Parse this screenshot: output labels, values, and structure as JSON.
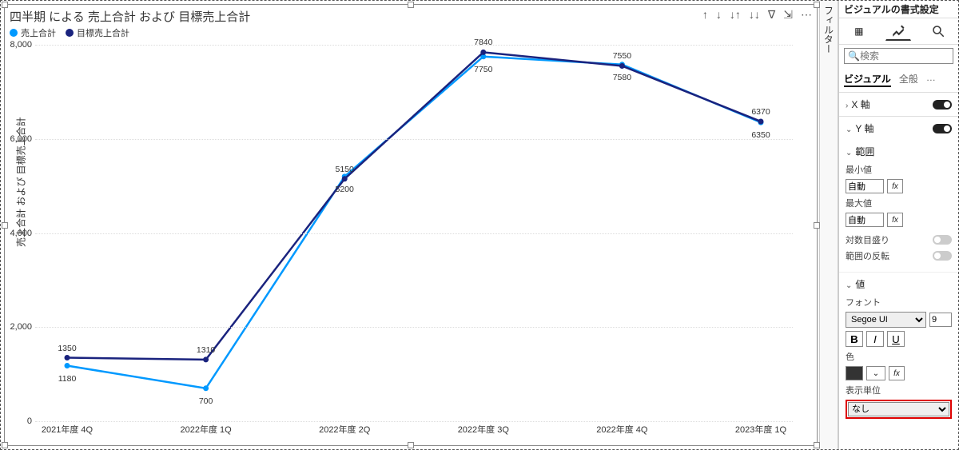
{
  "chart_data": {
    "type": "line",
    "title": "四半期 による 売上合計 および 目標売上合計",
    "ylabel": "売上合計 および 目標売上合計",
    "x_categories": [
      "2021年度 4Q",
      "2022年度 1Q",
      "2022年度 2Q",
      "2022年度 3Q",
      "2022年度 4Q",
      "2023年度 1Q"
    ],
    "y_ticks": [
      0,
      2000,
      4000,
      6000,
      8000
    ],
    "y_tick_labels": [
      "0",
      "2,000",
      "4,000",
      "6,000",
      "8,000"
    ],
    "ylim": [
      0,
      8000
    ],
    "series": [
      {
        "name": "売上合計",
        "color": "#0099ff",
        "values": [
          1180,
          700,
          5200,
          7750,
          7580,
          6350
        ]
      },
      {
        "name": "目標売上合計",
        "color": "#1a237e",
        "values": [
          1350,
          1310,
          5150,
          7840,
          7550,
          6370
        ]
      }
    ]
  },
  "toolbar_icons": [
    "↑",
    "↓",
    "↓↑",
    "↓↓",
    "∇",
    "⇲",
    "⋯"
  ],
  "sidebar_tab": "フィルター",
  "pane": {
    "header": "ビジュアルの書式設定",
    "search_placeholder": "検索",
    "tabs": {
      "visual": "ビジュアル",
      "general": "全般",
      "more": "…"
    },
    "x_axis": "X 軸",
    "y_axis": "Y 軸",
    "range": {
      "title": "範囲",
      "min_label": "最小値",
      "max_label": "最大値",
      "auto": "自動",
      "log": "対数目盛り",
      "invert": "範囲の反転"
    },
    "value": {
      "title": "値",
      "font_label": "フォント",
      "font_name": "Segoe UI",
      "font_size": "9",
      "color_label": "色",
      "unit_label": "表示単位",
      "unit_value": "なし",
      "fx": "fx"
    }
  }
}
